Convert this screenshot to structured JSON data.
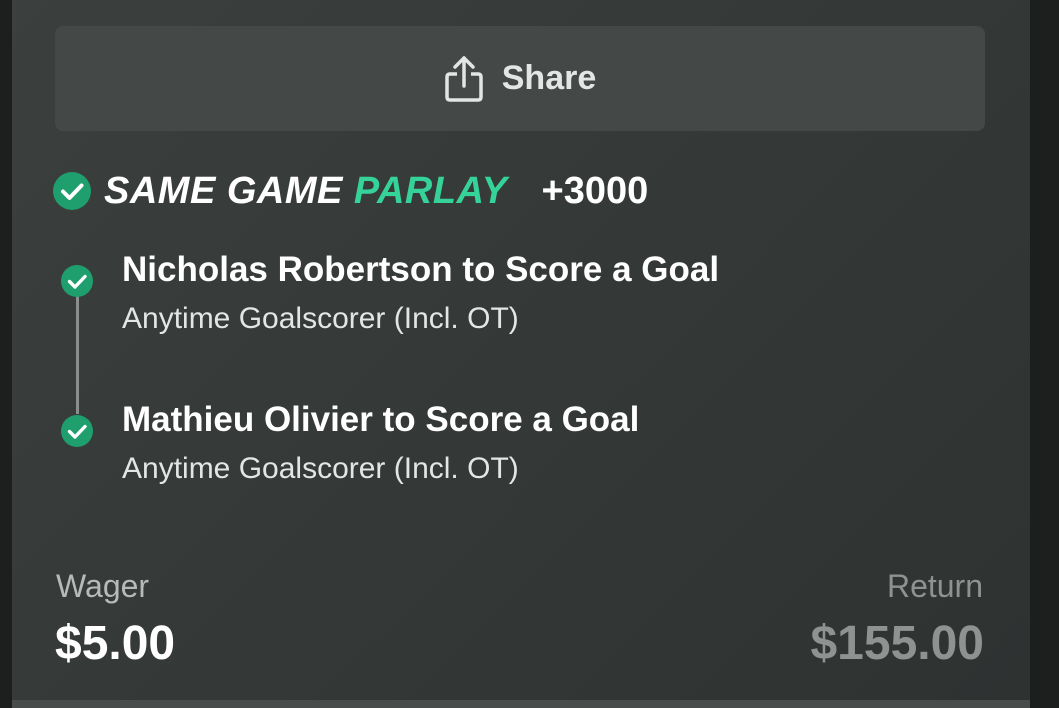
{
  "share": {
    "label": "Share",
    "icon": "share-icon"
  },
  "bet": {
    "type_primary": "SAME GAME",
    "type_accent": "PARLAY",
    "odds": "+3000",
    "status_icon": "check-circle-icon",
    "legs": [
      {
        "title": "Nicholas Robertson to Score a Goal",
        "market": "Anytime Goalscorer (Incl. OT)"
      },
      {
        "title": "Mathieu Olivier to Score a Goal",
        "market": "Anytime Goalscorer (Incl. OT)"
      }
    ]
  },
  "wager": {
    "label": "Wager",
    "value": "$5.00"
  },
  "return": {
    "label": "Return",
    "value": "$155.00"
  },
  "colors": {
    "accent": "#35d39a",
    "check": "#1f9e6e",
    "card_bg": "#383c3a",
    "button_bg": "#444947",
    "muted_text": "#8e9391"
  }
}
